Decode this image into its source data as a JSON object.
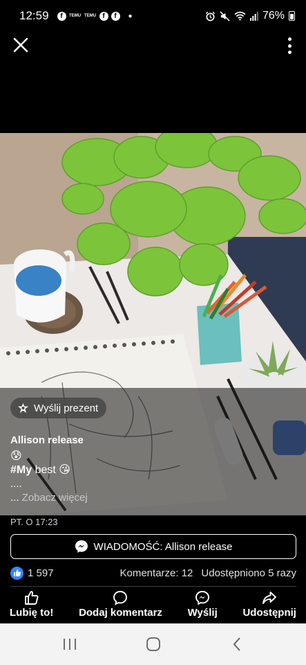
{
  "status_bar": {
    "time": "12:59",
    "apps": [
      "f",
      "TEMU",
      "TEMU",
      "f",
      "f"
    ],
    "battery": "76%",
    "icons": [
      "alarm-icon",
      "mute-icon",
      "wifi-icon",
      "signal-icon",
      "battery-icon"
    ]
  },
  "nav": {
    "close_icon": "close-icon",
    "more_icon": "more-vertical-icon"
  },
  "post": {
    "gift_label": "Wyślij prezent",
    "author": "Allison release",
    "emoji_1": "😰",
    "hashtag": "#My",
    "post_text": " best ",
    "emoji_2": "😘",
    "dots": "....",
    "see_more_prefix": "... ",
    "see_more": "Zobacz więcej",
    "timestamp": "PT. O 17:23"
  },
  "message_button": {
    "label": "WIADOMOŚĆ: Allison release"
  },
  "stats": {
    "likes": "1 597",
    "comments": "Komentarze: 12",
    "shares": "Udostępniono 5 razy"
  },
  "actions": [
    {
      "label": "Lubię to!",
      "icon": "thumbs-up-icon"
    },
    {
      "label": "Dodaj komentarz",
      "icon": "comment-icon"
    },
    {
      "label": "Wyślij",
      "icon": "messenger-icon"
    },
    {
      "label": "Udostępnij",
      "icon": "share-icon"
    }
  ],
  "colors": {
    "background": "#000000",
    "like_blue": "#2d88ff",
    "navbar": "#f3f3f3"
  }
}
